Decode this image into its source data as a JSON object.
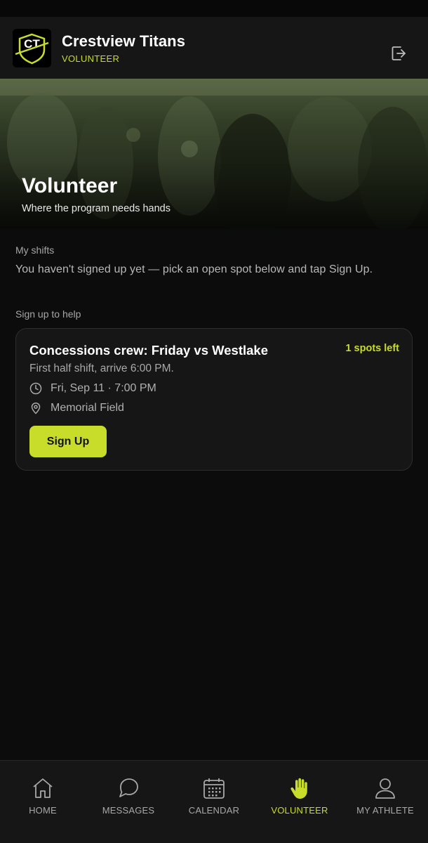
{
  "header": {
    "logo_text": "CT",
    "team_name": "Crestview Titans",
    "role": "VOLUNTEER"
  },
  "hero": {
    "title": "Volunteer",
    "subtitle": "Where the program needs hands"
  },
  "my_shifts": {
    "label": "My shifts",
    "empty_text": "You haven't signed up yet — pick an open spot below and tap Sign Up."
  },
  "sign_up": {
    "label": "Sign up to help",
    "cards": [
      {
        "title": "Concessions crew: Friday vs Westlake",
        "spots": "1 spots left",
        "description": "First half shift, arrive 6:00 PM.",
        "datetime": "Fri, Sep 11 · 7:00 PM",
        "location": "Memorial Field",
        "button": "Sign Up"
      }
    ]
  },
  "tabs": [
    {
      "label": "HOME",
      "icon": "home-icon",
      "active": false
    },
    {
      "label": "MESSAGES",
      "icon": "chat-icon",
      "active": false
    },
    {
      "label": "CALENDAR",
      "icon": "calendar-icon",
      "active": false
    },
    {
      "label": "VOLUNTEER",
      "icon": "hand-icon",
      "active": true
    },
    {
      "label": "MY ATHLETE",
      "icon": "user-icon",
      "active": false
    }
  ],
  "colors": {
    "accent": "#c8dc2a",
    "background": "#0c0c0c",
    "surface": "#161616"
  }
}
